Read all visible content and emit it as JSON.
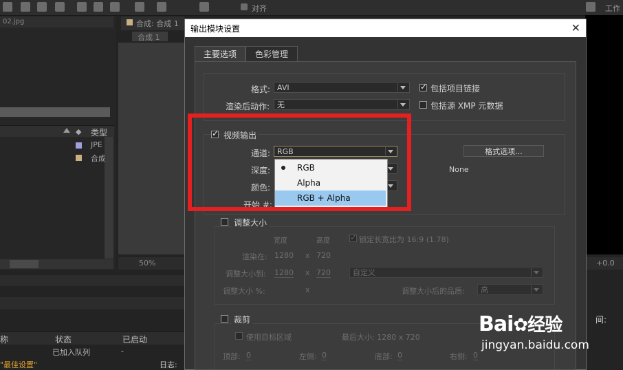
{
  "app": {
    "toolbar": {
      "snap_label": "对齐",
      "workspace_label": "工作"
    },
    "project_panel": {
      "tab_label": "02.jpg",
      "column_type": "类型",
      "rows": [
        {
          "type": "JPE",
          "color": "#a0a0e0"
        },
        {
          "type": "合成",
          "color": "#c8b080"
        }
      ]
    },
    "composition": {
      "tab_label": "合成: 合成 1",
      "sub_tab": "合成 1",
      "zoom": "50%"
    },
    "right_panel": {
      "value": "+0.0"
    },
    "render_queue": {
      "columns": [
        "称",
        "状态",
        "已启动"
      ],
      "row": {
        "status": "已加入队列",
        "started": "-"
      },
      "footer_label": "\"最佳设置\"",
      "log_label": "日志:",
      "time_label": "间:"
    }
  },
  "dialog": {
    "title": "输出模块设置",
    "close_icon": "close-icon",
    "tabs": [
      "主要选项",
      "色彩管理"
    ],
    "format": {
      "label": "格式:",
      "value": "AVI"
    },
    "post_render": {
      "label": "渲染后动作:",
      "value": "无"
    },
    "include_project_link": {
      "label": "包括项目链接",
      "checked": true
    },
    "include_xmp": {
      "label": "包括源 XMP 元数据",
      "checked": false
    },
    "video_output": {
      "label": "视频输出",
      "checked": true,
      "channels": {
        "label": "通道:",
        "value": "RGB"
      },
      "depth": {
        "label": "深度:"
      },
      "color": {
        "label": "颜色:"
      },
      "start": {
        "label": "开始 #:"
      },
      "format_options_button": "格式选项...",
      "codec_value": "None"
    },
    "channel_menu": {
      "options": [
        "RGB",
        "Alpha",
        "RGB + Alpha"
      ],
      "checked_index": 0,
      "highlighted_index": 2
    },
    "resize": {
      "label": "调整大小",
      "checked": false,
      "width_label": "宽度",
      "height_label": "高度",
      "lock_aspect": "锁定长宽比为 16:9 (1.78)",
      "render_at_label": "渲染在:",
      "render_w": "1280",
      "render_h": "720",
      "resize_to_label": "调整大小到:",
      "resize_w": "1280",
      "resize_h": "720",
      "preset": "自定义",
      "percent_label": "调整大小 %:",
      "x": "x",
      "quality_label": "调整大小后的品质:",
      "quality": "高"
    },
    "crop": {
      "label": "裁剪",
      "checked": false,
      "use_roi": "使用目标区域",
      "final_size": "最后大小: 1280 x 720",
      "top_label": "顶部:",
      "top": "0",
      "left_label": "左侧:",
      "left": "0",
      "bottom_label": "底部:",
      "bottom": "0",
      "right_label": "右侧:",
      "right": "0"
    }
  },
  "watermark": {
    "brand": "Bai",
    "brand2": "经验",
    "url": "jingyan.baidu.com"
  },
  "colors": {
    "highlight": "#99c9ef",
    "annotation_red": "#e42020",
    "dialog_bg": "#333333"
  }
}
